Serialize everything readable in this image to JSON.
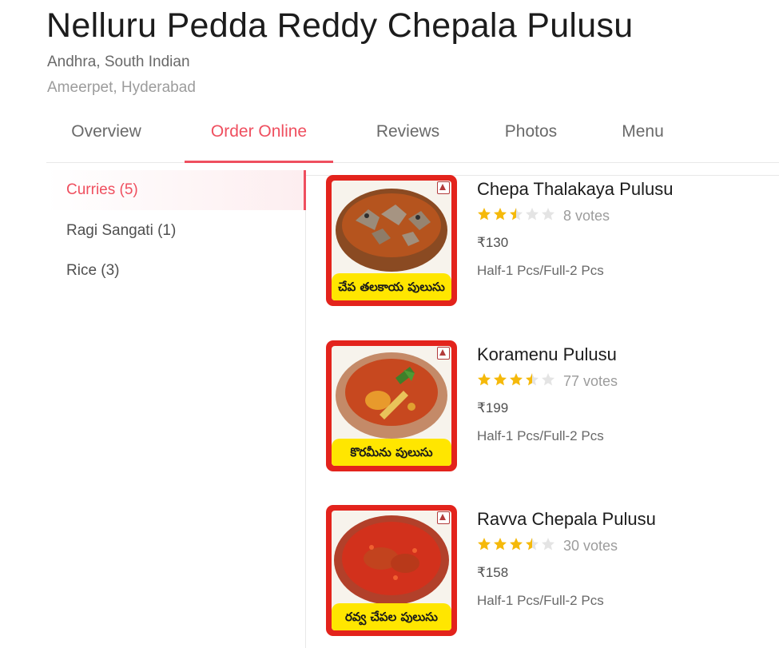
{
  "restaurant": {
    "name": "Nelluru Pedda Reddy Chepala Pulusu",
    "cuisines": "Andhra, South Indian",
    "locality": "Ameerpet, Hyderabad"
  },
  "tabs": [
    {
      "label": "Overview",
      "active": false
    },
    {
      "label": "Order Online",
      "active": true
    },
    {
      "label": "Reviews",
      "active": false
    },
    {
      "label": "Photos",
      "active": false
    },
    {
      "label": "Menu",
      "active": false
    }
  ],
  "categories": [
    {
      "label": "Curries (5)",
      "active": true
    },
    {
      "label": "Ragi Sangati (1)",
      "active": false
    },
    {
      "label": "Rice (3)",
      "active": false
    }
  ],
  "dishes": [
    {
      "name": "Chepa Thalakaya Pulusu",
      "rating": 2.5,
      "votes": "8 votes",
      "price": "₹130",
      "description": "Half-1 Pcs/Full-2 Pcs",
      "image_caption": "చేప తలకాయ పులుసు",
      "curry_color": "#b5541e"
    },
    {
      "name": "Koramenu Pulusu",
      "rating": 3.5,
      "votes": "77 votes",
      "price": "₹199",
      "description": "Half-1 Pcs/Full-2 Pcs",
      "image_caption": "కొరమీను పులుసు",
      "curry_color": "#c7481f"
    },
    {
      "name": "Ravva Chepala Pulusu",
      "rating": 3.5,
      "votes": "30 votes",
      "price": "₹158",
      "description": "Half-1 Pcs/Full-2 Pcs",
      "image_caption": "రవ్వ చేపల పులుసు",
      "curry_color": "#d2311c"
    }
  ],
  "colors": {
    "accent": "#ef4f5f",
    "star_filled": "#f5b90a",
    "star_empty": "#e4e4e4",
    "image_frame": "#e3231c",
    "banner": "#ffe600"
  },
  "icons": {
    "star": "star-icon",
    "non_veg": "non-veg-icon"
  }
}
